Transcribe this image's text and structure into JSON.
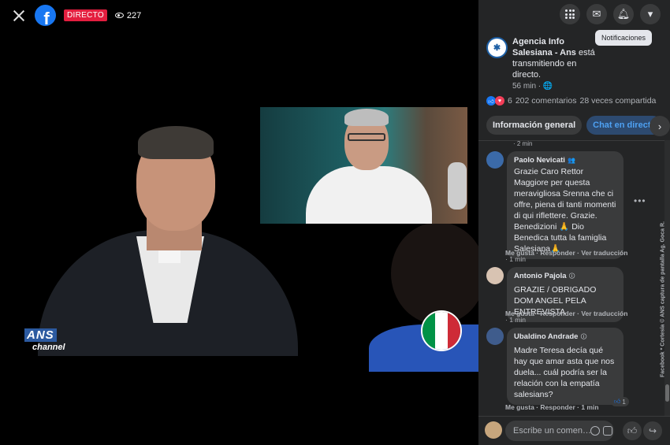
{
  "video": {
    "live_label": "DIRECTO",
    "viewer_count": "227",
    "ans_logo_text": "ANS",
    "ans_logo_sub": "channel",
    "flag_colors": [
      "#009246",
      "#ffffff",
      "#ce2b37"
    ]
  },
  "panel": {
    "tooltip": "Notificaciones",
    "page_name": "Agencia Info Salesiana - Ans",
    "page_action": "está transmitiendo en directo.",
    "page_time": "56 min · 🌐",
    "reaction_count": "6",
    "comments_count": "202 comentarios",
    "shares_count": "28 veces compartida",
    "tabs": [
      {
        "label": "Información general",
        "active": false
      },
      {
        "label": "Chat en directo",
        "active": true
      }
    ],
    "prev_time": "· 2 min",
    "comments": [
      {
        "name": "Paolo Nevicati",
        "badge": "👥",
        "text": "Grazie Caro Rettor Maggiore per questa meravigliosa Srenna che ci offre, piena di tanti momenti di qui riflettere. Grazie. Benedizioni 🙏 Dio Benedica tutta la famiglia Salesiana🙏",
        "actions": "Me gusta · Responder · Ver traducción",
        "time": "· 1 min"
      },
      {
        "name": "Antonio Pajola",
        "badge": "🛈",
        "text": "GRAZIE / OBRIGADO DOM ANGEL PELA ENTREVISTA",
        "actions": "Me gusta · Responder · Ver traducción",
        "time": "· 1 min"
      },
      {
        "name": "Ubaldino Andrade",
        "badge": "🛈",
        "text": "Madre Teresa decía qué hay que amar asta que nos duela... cuál podría ser la relación con la empatía salesians?",
        "actions": "Me gusta · Responder · 1 min",
        "time": "",
        "likes": "1"
      }
    ],
    "composer_placeholder": "Escribe un comen…",
    "watermark": "Facebook * Cortesía © ANS captura de pantalla Ag. Goca R."
  }
}
